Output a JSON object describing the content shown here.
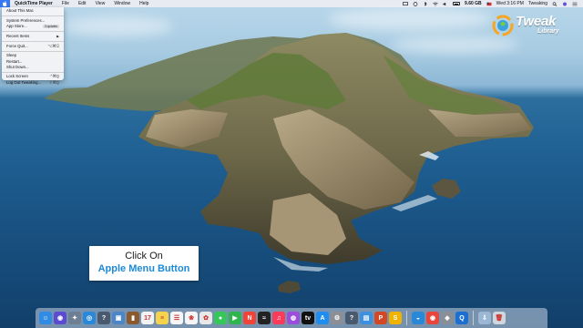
{
  "menubar": {
    "app_name": "QuickTime Player",
    "menus": [
      "File",
      "Edit",
      "View",
      "Window",
      "Help"
    ],
    "status": {
      "battery_percent": "",
      "network_speed": "9.60 GB",
      "datetime": "Wed 3:16 PM",
      "user": "Tweaking"
    }
  },
  "apple_menu": {
    "items": [
      {
        "label": "About This Mac",
        "shortcut": ""
      },
      {
        "label": "System Preferences...",
        "shortcut": ""
      },
      {
        "label": "App Store...",
        "badge": "3 updates"
      },
      {
        "label": "Recent Items",
        "submenu": "▶"
      },
      {
        "label": "Force Quit...",
        "shortcut": "⌥⌘⎋"
      },
      {
        "label": "Sleep",
        "shortcut": ""
      },
      {
        "label": "Restart...",
        "shortcut": ""
      },
      {
        "label": "Shut Down...",
        "shortcut": ""
      },
      {
        "label": "Lock Screen",
        "shortcut": "^⌘Q"
      },
      {
        "label": "Log Out Tweaking...",
        "shortcut": "⇧⌘Q"
      }
    ]
  },
  "logo": {
    "word1": "Tweak",
    "word2": "Library"
  },
  "callout": {
    "line1": "Click On",
    "line2": "Apple Menu Button"
  },
  "dock": {
    "apps": [
      {
        "name": "finder-icon",
        "glyph": "☺",
        "color": "#2f8be3"
      },
      {
        "name": "siri-icon",
        "glyph": "◉",
        "color": "#5b4bd1"
      },
      {
        "name": "launchpad-icon",
        "glyph": "✦",
        "color": "#6f7f93"
      },
      {
        "name": "safari-icon",
        "glyph": "◎",
        "color": "#2a88d8"
      },
      {
        "name": "help-icon",
        "glyph": "?",
        "color": "#4a5a6e"
      },
      {
        "name": "photo-viewer-icon",
        "glyph": "▣",
        "color": "#4c86c6"
      },
      {
        "name": "book-icon",
        "glyph": "▮",
        "color": "#8a5a2e"
      },
      {
        "name": "calendar-icon",
        "glyph": "17",
        "color": "#f2f2f2"
      },
      {
        "name": "notes-icon",
        "glyph": "≡",
        "color": "#f5d44c"
      },
      {
        "name": "reminders-icon",
        "glyph": "☰",
        "color": "#f5f5f5"
      },
      {
        "name": "photos-app-icon",
        "glyph": "❀",
        "color": "#f5f5f5"
      },
      {
        "name": "photos-icon",
        "glyph": "✿",
        "color": "#e8e8e8"
      },
      {
        "name": "messages-icon",
        "glyph": "●",
        "color": "#35c759"
      },
      {
        "name": "facetime-icon",
        "glyph": "▶",
        "color": "#2fb54e"
      },
      {
        "name": "news-icon",
        "glyph": "N",
        "color": "#f0443a"
      },
      {
        "name": "stocks-icon",
        "glyph": "≈",
        "color": "#222222"
      },
      {
        "name": "music-icon",
        "glyph": "♫",
        "color": "#fa3b5a"
      },
      {
        "name": "podcasts-icon",
        "glyph": "◍",
        "color": "#9b4ddc"
      },
      {
        "name": "tv-icon",
        "glyph": "tv",
        "color": "#111111"
      },
      {
        "name": "app-store-icon",
        "glyph": "A",
        "color": "#1f8cf0"
      },
      {
        "name": "system-preferences-icon",
        "glyph": "⚙",
        "color": "#8d8f95"
      },
      {
        "name": "help-viewer-icon",
        "glyph": "?",
        "color": "#4a5a6e"
      },
      {
        "name": "keynote-icon",
        "glyph": "▤",
        "color": "#3d8fe0"
      },
      {
        "name": "powerpoint-icon",
        "glyph": "P",
        "color": "#d24726"
      },
      {
        "name": "slides-icon",
        "glyph": "S",
        "color": "#f0b400"
      }
    ],
    "apps2": [
      {
        "name": "spotlight-icon",
        "glyph": "◒",
        "color": "#2a88d8"
      },
      {
        "name": "chrome-icon",
        "glyph": "◉",
        "color": "#e8453c"
      },
      {
        "name": "disk-utility-icon",
        "glyph": "◈",
        "color": "#8a8f97"
      },
      {
        "name": "quicktime-icon",
        "glyph": "Q",
        "color": "#1c6fd0"
      }
    ],
    "folders": [
      {
        "name": "downloads-folder-icon",
        "glyph": "⇩",
        "color": "#9bb7d4"
      },
      {
        "name": "trash-icon",
        "glyph": "🗑",
        "color": "#cfd6de"
      }
    ]
  }
}
